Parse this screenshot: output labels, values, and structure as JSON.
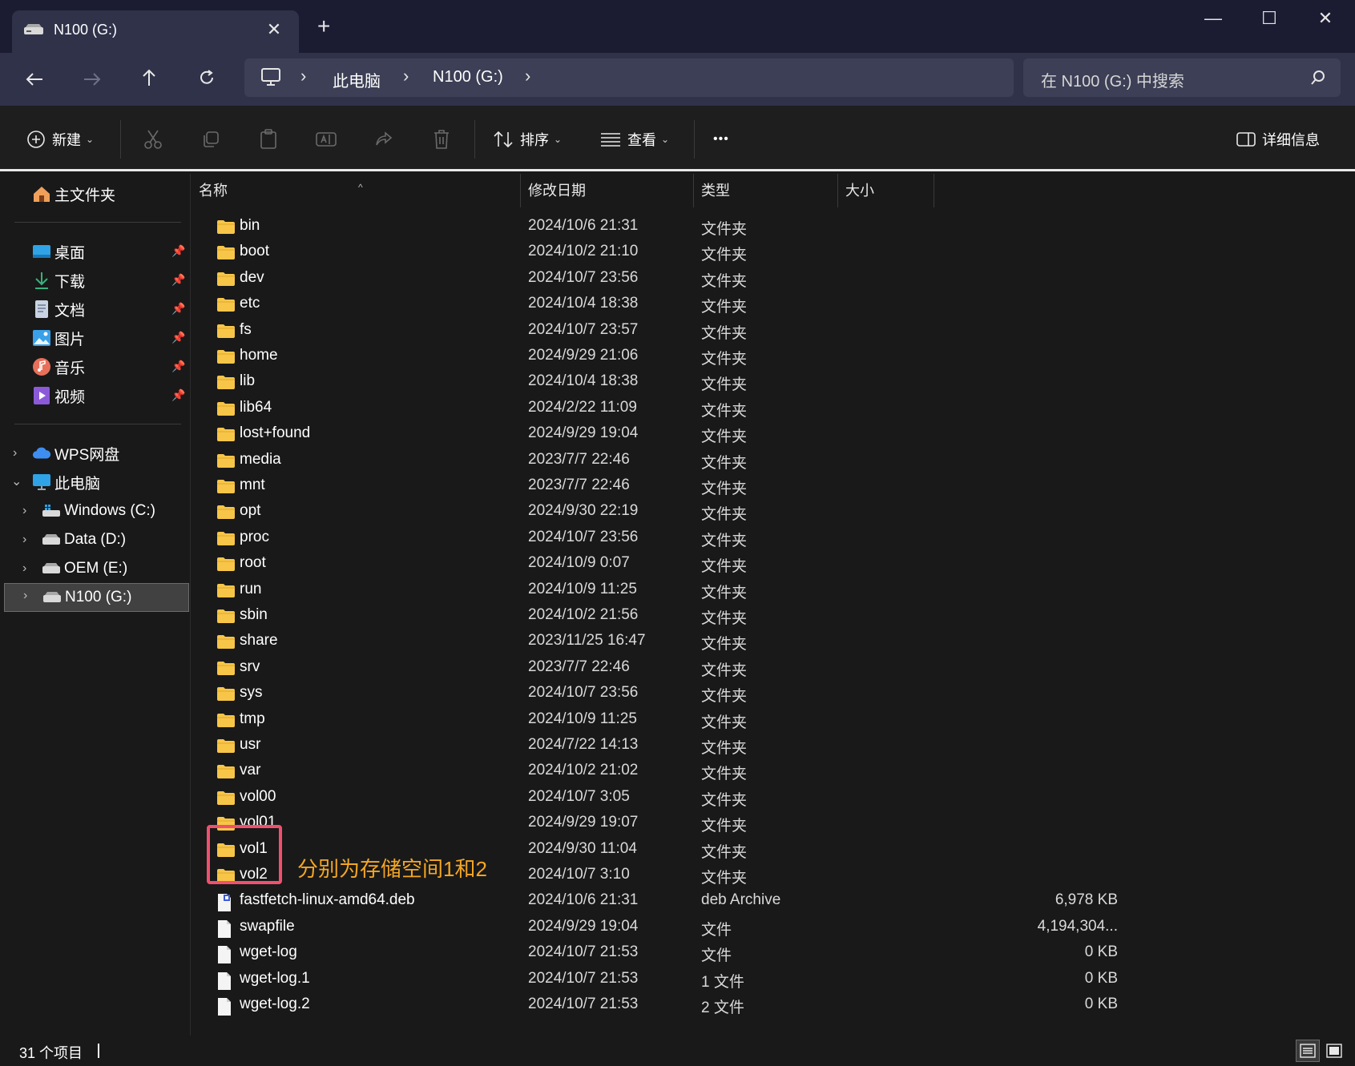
{
  "window": {
    "tab_title": "N100 (G:)",
    "close_tab_glyph": "✕",
    "new_tab_glyph": "+",
    "minimize_glyph": "—",
    "maximize_glyph": "☐",
    "close_glyph": "✕"
  },
  "address": {
    "chevron": "›",
    "segments": [
      "此电脑",
      "N100 (G:)"
    ]
  },
  "search": {
    "placeholder": "在 N100 (G:) 中搜索"
  },
  "toolbar": {
    "new_label": "新建",
    "sort_label": "排序",
    "view_label": "查看",
    "more_label": "•••",
    "details_label": "详细信息"
  },
  "sidebar": {
    "home": "主文件夹",
    "pinned": [
      "桌面",
      "下载",
      "文档",
      "图片",
      "音乐",
      "视频"
    ],
    "wps": "WPS网盘",
    "this_pc": "此电脑",
    "drives": [
      "Windows (C:)",
      "Data (D:)",
      "OEM (E:)",
      "N100 (G:)"
    ]
  },
  "columns": {
    "name": "名称",
    "date": "修改日期",
    "type": "类型",
    "size": "大小"
  },
  "files": [
    {
      "name": "bin",
      "date": "2024/10/6 21:31",
      "type": "文件夹",
      "size": "",
      "kind": "folder"
    },
    {
      "name": "boot",
      "date": "2024/10/2 21:10",
      "type": "文件夹",
      "size": "",
      "kind": "folder"
    },
    {
      "name": "dev",
      "date": "2024/10/7 23:56",
      "type": "文件夹",
      "size": "",
      "kind": "folder"
    },
    {
      "name": "etc",
      "date": "2024/10/4 18:38",
      "type": "文件夹",
      "size": "",
      "kind": "folder"
    },
    {
      "name": "fs",
      "date": "2024/10/7 23:57",
      "type": "文件夹",
      "size": "",
      "kind": "folder"
    },
    {
      "name": "home",
      "date": "2024/9/29 21:06",
      "type": "文件夹",
      "size": "",
      "kind": "folder"
    },
    {
      "name": "lib",
      "date": "2024/10/4 18:38",
      "type": "文件夹",
      "size": "",
      "kind": "folder"
    },
    {
      "name": "lib64",
      "date": "2024/2/22 11:09",
      "type": "文件夹",
      "size": "",
      "kind": "folder"
    },
    {
      "name": "lost+found",
      "date": "2024/9/29 19:04",
      "type": "文件夹",
      "size": "",
      "kind": "folder"
    },
    {
      "name": "media",
      "date": "2023/7/7 22:46",
      "type": "文件夹",
      "size": "",
      "kind": "folder"
    },
    {
      "name": "mnt",
      "date": "2023/7/7 22:46",
      "type": "文件夹",
      "size": "",
      "kind": "folder"
    },
    {
      "name": "opt",
      "date": "2024/9/30 22:19",
      "type": "文件夹",
      "size": "",
      "kind": "folder"
    },
    {
      "name": "proc",
      "date": "2024/10/7 23:56",
      "type": "文件夹",
      "size": "",
      "kind": "folder"
    },
    {
      "name": "root",
      "date": "2024/10/9 0:07",
      "type": "文件夹",
      "size": "",
      "kind": "folder"
    },
    {
      "name": "run",
      "date": "2024/10/9 11:25",
      "type": "文件夹",
      "size": "",
      "kind": "folder"
    },
    {
      "name": "sbin",
      "date": "2024/10/2 21:56",
      "type": "文件夹",
      "size": "",
      "kind": "folder"
    },
    {
      "name": "share",
      "date": "2023/11/25 16:47",
      "type": "文件夹",
      "size": "",
      "kind": "folder"
    },
    {
      "name": "srv",
      "date": "2023/7/7 22:46",
      "type": "文件夹",
      "size": "",
      "kind": "folder"
    },
    {
      "name": "sys",
      "date": "2024/10/7 23:56",
      "type": "文件夹",
      "size": "",
      "kind": "folder"
    },
    {
      "name": "tmp",
      "date": "2024/10/9 11:25",
      "type": "文件夹",
      "size": "",
      "kind": "folder"
    },
    {
      "name": "usr",
      "date": "2024/7/22 14:13",
      "type": "文件夹",
      "size": "",
      "kind": "folder"
    },
    {
      "name": "var",
      "date": "2024/10/2 21:02",
      "type": "文件夹",
      "size": "",
      "kind": "folder"
    },
    {
      "name": "vol00",
      "date": "2024/10/7 3:05",
      "type": "文件夹",
      "size": "",
      "kind": "folder"
    },
    {
      "name": "vol01",
      "date": "2024/9/29 19:07",
      "type": "文件夹",
      "size": "",
      "kind": "folder"
    },
    {
      "name": "vol1",
      "date": "2024/9/30 11:04",
      "type": "文件夹",
      "size": "",
      "kind": "folder"
    },
    {
      "name": "vol2",
      "date": "2024/10/7 3:10",
      "type": "文件夹",
      "size": "",
      "kind": "folder"
    },
    {
      "name": "fastfetch-linux-amd64.deb",
      "date": "2024/10/6 21:31",
      "type": "deb Archive",
      "size": "6,978 KB",
      "kind": "deb"
    },
    {
      "name": "swapfile",
      "date": "2024/9/29 19:04",
      "type": "文件",
      "size": "4,194,304...",
      "kind": "file"
    },
    {
      "name": "wget-log",
      "date": "2024/10/7 21:53",
      "type": "文件",
      "size": "0 KB",
      "kind": "file"
    },
    {
      "name": "wget-log.1",
      "date": "2024/10/7 21:53",
      "type": "1 文件",
      "size": "0 KB",
      "kind": "file"
    },
    {
      "name": "wget-log.2",
      "date": "2024/10/7 21:53",
      "type": "2 文件",
      "size": "0 KB",
      "kind": "file"
    }
  ],
  "annotation": "分别为存储空间1和2",
  "status": {
    "item_count": "31 个项目"
  },
  "colors": {
    "folder": "#f7c548",
    "annotation": "#f5a623",
    "highlight": "#f0506e",
    "titlebar": "#1b1c31",
    "navbar": "#2f3249"
  }
}
